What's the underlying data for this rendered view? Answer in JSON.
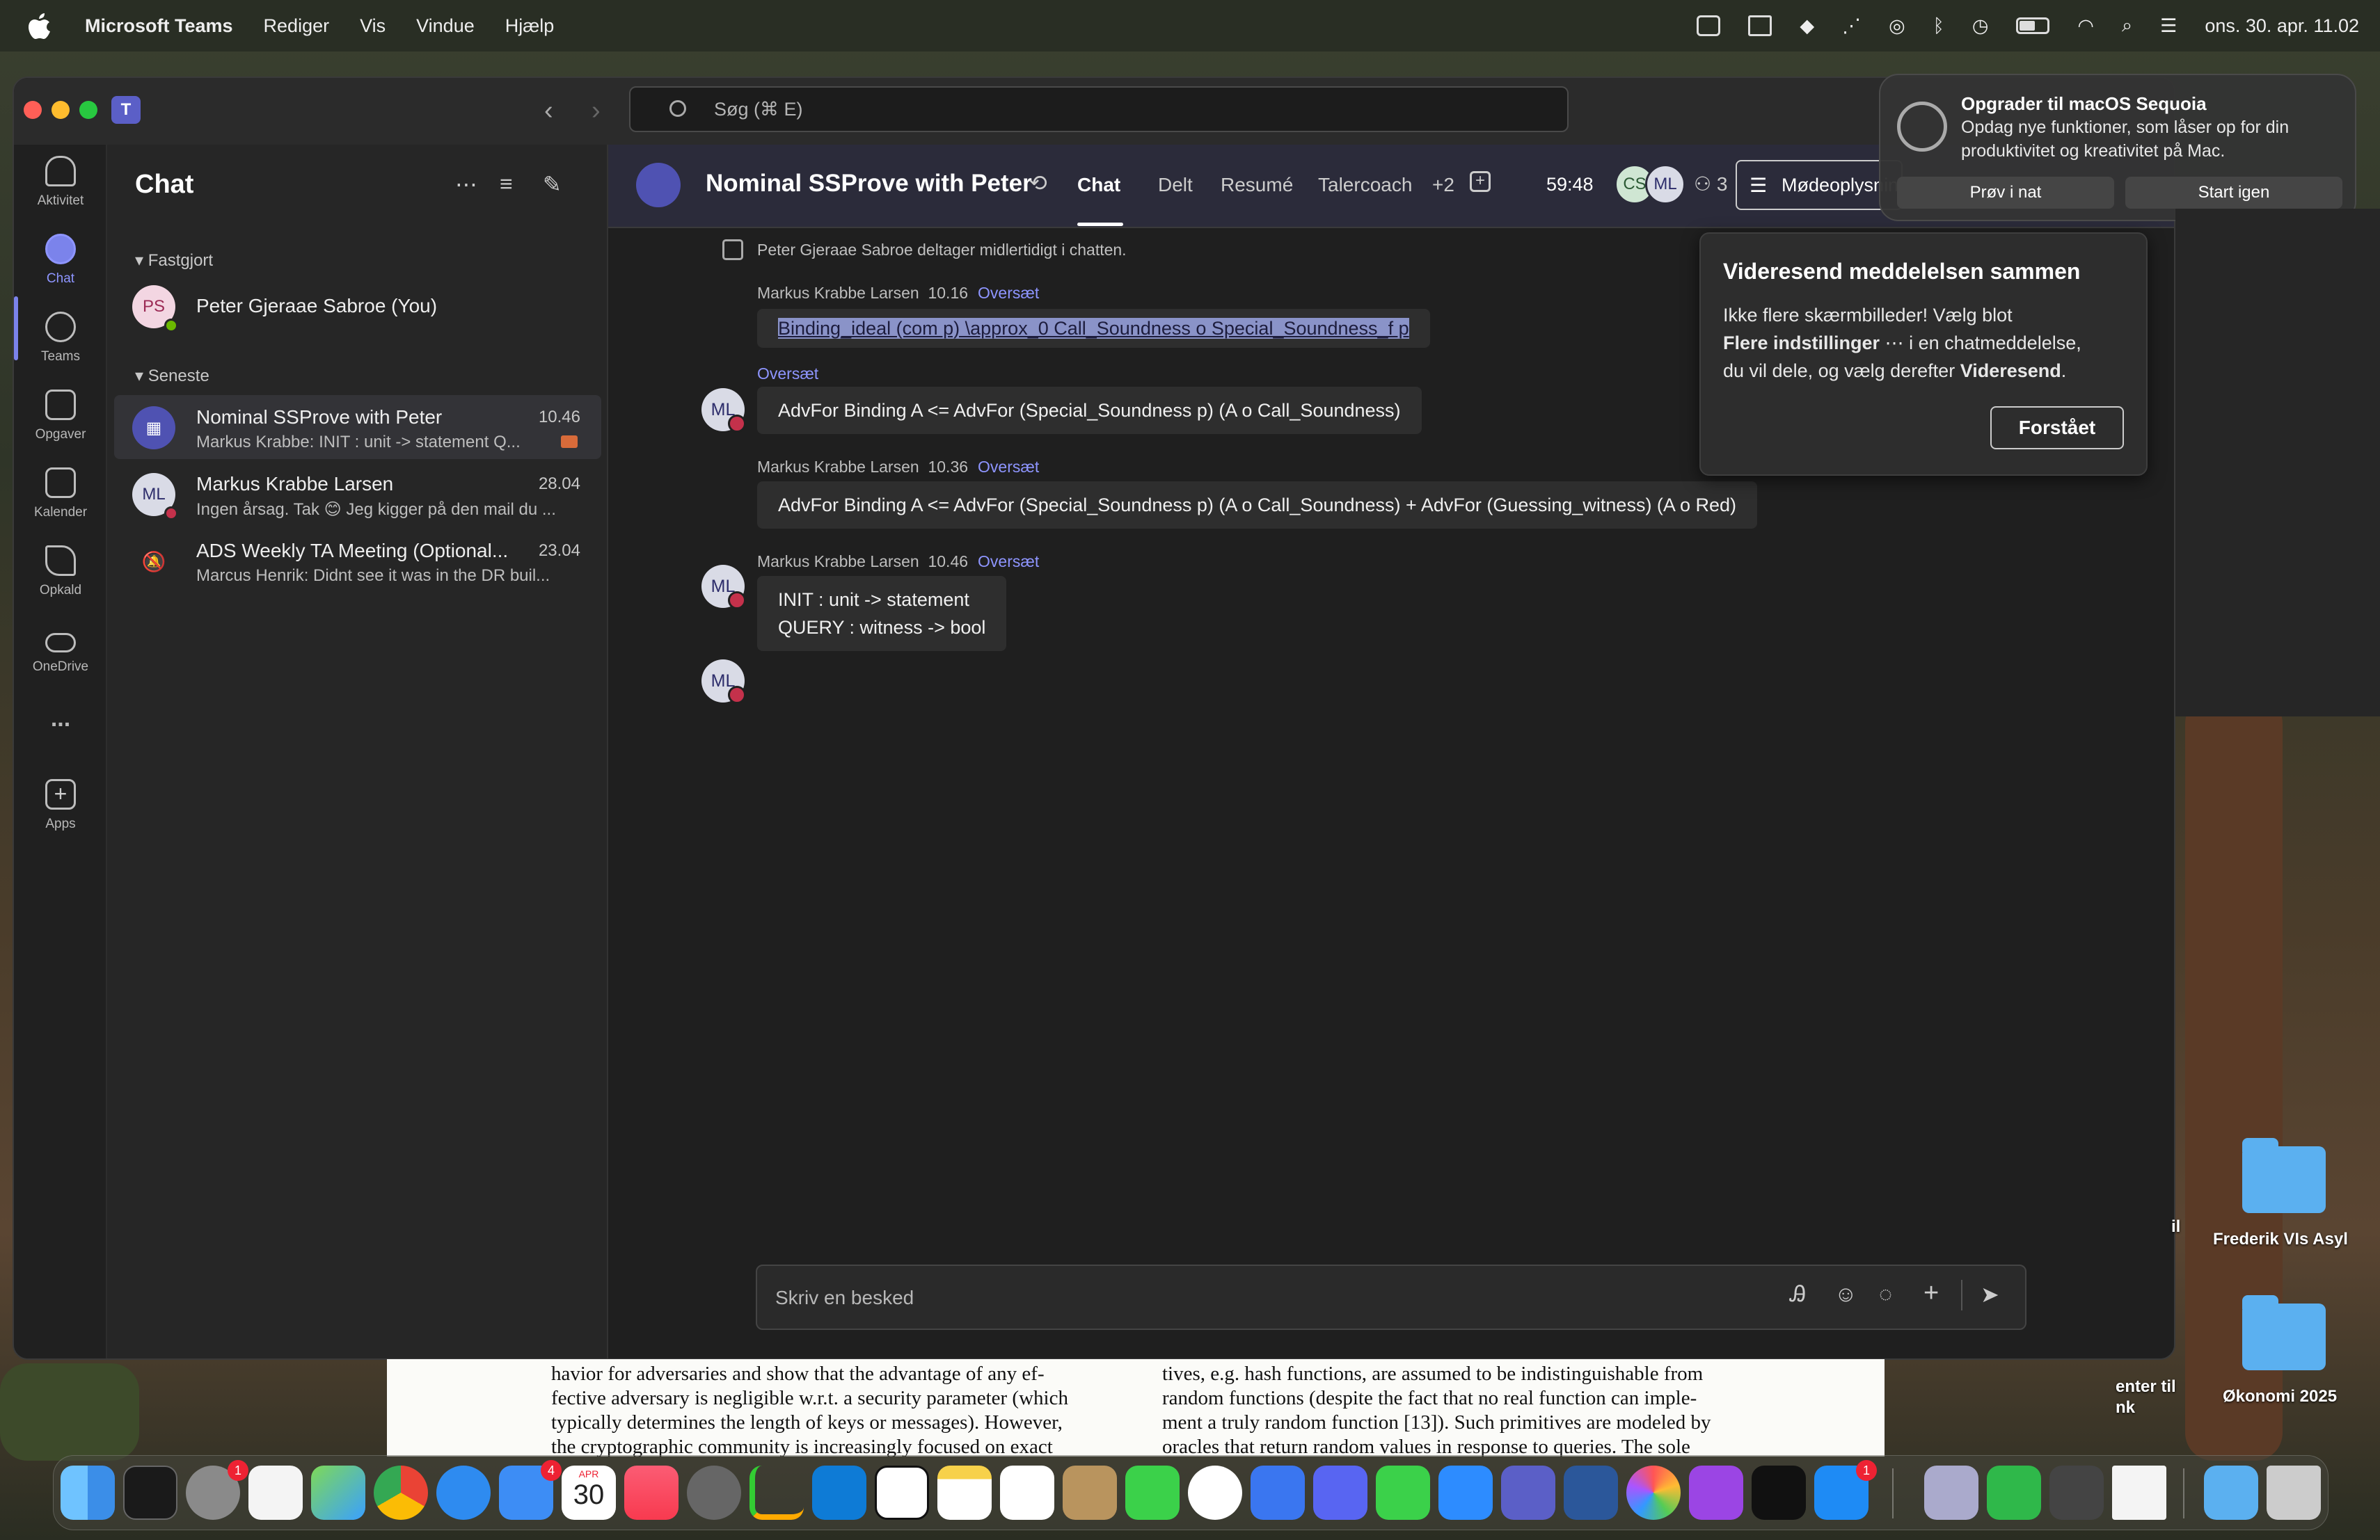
{
  "menubar": {
    "app": "Microsoft Teams",
    "menus": [
      "Rediger",
      "Vis",
      "Vindue",
      "Hjælp"
    ],
    "clock": "ons. 30. apr.  11.02"
  },
  "search": {
    "placeholder": "Søg (⌘ E)"
  },
  "rail": [
    {
      "label": "Aktivitet",
      "icon": "bell-icon"
    },
    {
      "label": "Chat",
      "icon": "chat-icon",
      "active": true
    },
    {
      "label": "Teams",
      "icon": "teams-icon"
    },
    {
      "label": "Opgaver",
      "icon": "tasks-icon"
    },
    {
      "label": "Kalender",
      "icon": "calendar-icon"
    },
    {
      "label": "Opkald",
      "icon": "phone-icon"
    },
    {
      "label": "OneDrive",
      "icon": "cloud-icon"
    },
    {
      "label": "...",
      "icon": "more-icon"
    },
    {
      "label": "Apps",
      "icon": "add-app-icon"
    }
  ],
  "chatlist": {
    "title": "Chat",
    "pinned_label": "Fastgjort",
    "recent_label": "Seneste",
    "pinned": [
      {
        "initials": "PS",
        "name": "Peter Gjeraae Sabroe (You)"
      }
    ],
    "recent": [
      {
        "name": "Nominal SSProve with Peter",
        "time": "10.46",
        "preview": "Markus Krabbe: INIT : unit -> statement Q..."
      },
      {
        "initials": "ML",
        "name": "Markus Krabbe Larsen",
        "time": "28.04",
        "preview": "Ingen årsag. Tak 😊 Jeg kigger på den mail du ..."
      },
      {
        "name": "ADS Weekly TA Meeting (Optional...",
        "time": "23.04",
        "preview": "Marcus Henrik: Didnt see it was in the DR buil..."
      }
    ]
  },
  "header": {
    "title": "Nominal SSProve with Peter",
    "tabs": [
      "Chat",
      "Delt",
      "Resumé",
      "Talercoach",
      "+2"
    ],
    "timer": "59:48",
    "participants": [
      "CS",
      "ML"
    ],
    "participant_count": "3",
    "meeting_info": "Mødeoplysninger"
  },
  "messages": {
    "system": "Peter Gjeraae Sabroe deltager midlertidigt i chatten.",
    "translate": "Oversæt",
    "groups": [
      {
        "author": "Markus Krabbe Larsen",
        "time": "10.16",
        "avatar": "ML",
        "lines": [
          "Binding_ideal (com p) \\approx_0 Call_Soundness o Special_Soundness_f p",
          "AdvFor Binding A <= AdvFor (Special_Soundness p) (A o Call_Soundness)"
        ]
      },
      {
        "author": "Markus Krabbe Larsen",
        "time": "10.36",
        "avatar": "ML",
        "lines": [
          "AdvFor Binding A <= AdvFor (Special_Soundness p) (A o Call_Soundness) + AdvFor (Guessing_witness) (A o Red)"
        ]
      },
      {
        "author": "Markus Krabbe Larsen",
        "time": "10.46",
        "avatar": "ML",
        "lines": [
          "INIT : unit -> statement",
          "QUERY : witness -> bool"
        ]
      }
    ]
  },
  "compose": {
    "placeholder": "Skriv en besked"
  },
  "popup": {
    "title": "Videresend meddelelsen sammen",
    "line1": "Ikke flere skærmbilleder! Vælg blot",
    "bold1": "Flere indstillinger",
    "line2": "i en chatmeddelelse,",
    "line3": "du vil dele, og vælg derefter",
    "bold2": "Videresend",
    "ok": "Forstået"
  },
  "notification": {
    "title": "Opgrader til macOS Sequoia",
    "body": "Opdag nye funktioner, som låser op for din produktivitet og kreativitet på Mac.",
    "btn1": "Prøv i nat",
    "btn2": "Start igen"
  },
  "paper": {
    "left": [
      "havior for adversaries and show that the advantage of any ef-",
      "fective adversary is negligible w.r.t. a security parameter (which",
      "typically determines the length of keys or messages). However,",
      "the cryptographic community is increasingly focused on exact"
    ],
    "right": [
      "tives, e.g. hash functions, are assumed to be indistinguishable from",
      "random functions (despite the fact that no real function can imple-",
      "ment a truly random function [13]). Such primitives are modeled by",
      "oracles that return random values in response to queries. The sole"
    ]
  },
  "desktop": {
    "folders": [
      "Frederik VIs Asyl",
      "Økonomi 2025"
    ],
    "fragments": [
      "il",
      "enter til",
      "nk"
    ]
  },
  "dock": {
    "badges": {
      "settings": "1",
      "mail": "4",
      "appstore": "1"
    },
    "calendar_month": "APR",
    "calendar_day": "30"
  },
  "colors": {
    "accent": "#7b83eb",
    "presence_busy": "#c4314b",
    "teams_bg": "#1f1f1f"
  }
}
